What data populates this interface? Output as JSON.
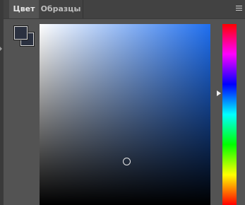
{
  "panel": {
    "tabs": [
      {
        "label": "Цвет",
        "active": true
      },
      {
        "label": "Образцы",
        "active": false
      }
    ],
    "menu_icon": "menu-icon"
  },
  "color": {
    "foreground": "#2b3140",
    "background": "#2b3140",
    "hue_base": "#1f6ff0",
    "accent_border": "#d8d8d8"
  },
  "icons": {
    "panel_menu": "hamburger-menu-icon",
    "hue_marker": "triangle-right-icon",
    "field_cursor": "circle-icon"
  }
}
